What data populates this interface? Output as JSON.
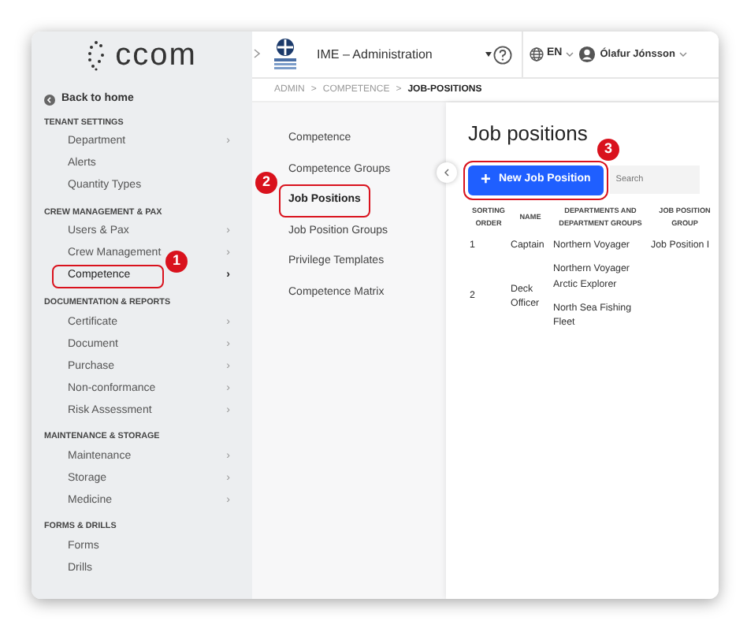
{
  "logo": {
    "text": "ccom"
  },
  "header": {
    "org_name": "IME – Administration",
    "language": "EN",
    "user": "Ólafur Jónsson"
  },
  "breadcrumb": [
    {
      "label": "ADMIN",
      "current": false
    },
    {
      "label": "COMPETENCE",
      "current": false
    },
    {
      "label": "JOB-POSITIONS",
      "current": true
    }
  ],
  "breadcrumb_separator": ">",
  "sidebar": {
    "back": "Back to home",
    "sections": [
      {
        "title": "TENANT SETTINGS",
        "items": [
          {
            "label": "Department",
            "chevron": "›",
            "selected": false
          },
          {
            "label": "Alerts",
            "selected": false
          },
          {
            "label": "Quantity Types",
            "selected": false
          }
        ]
      },
      {
        "title": "CREW MANAGEMENT & PAX",
        "items": [
          {
            "label": "Users & Pax",
            "chevron": "›",
            "selected": false
          },
          {
            "label": "Crew Management",
            "chevron": "›",
            "selected": false
          },
          {
            "label": "Competence",
            "chevron": "›",
            "selected": true,
            "callout": "1"
          }
        ]
      },
      {
        "title": "DOCUMENTATION & REPORTS",
        "items": [
          {
            "label": "Certificate",
            "chevron": "›",
            "selected": false
          },
          {
            "label": "Document",
            "chevron": "›",
            "selected": false
          },
          {
            "label": "Purchase",
            "chevron": "›",
            "selected": false
          },
          {
            "label": "Non-conformance",
            "chevron": "›",
            "selected": false
          },
          {
            "label": "Risk Assessment",
            "chevron": "›",
            "selected": false
          }
        ]
      },
      {
        "title": "MAINTENANCE & STORAGE",
        "items": [
          {
            "label": "Maintenance",
            "chevron": "›",
            "selected": false
          },
          {
            "label": "Storage",
            "chevron": "›",
            "selected": false
          },
          {
            "label": "Medicine",
            "chevron": "›",
            "selected": false
          }
        ]
      },
      {
        "title": "FORMS & DRILLS",
        "items": [
          {
            "label": "Forms",
            "selected": false
          },
          {
            "label": "Drills",
            "selected": false
          }
        ]
      }
    ]
  },
  "submenu": [
    {
      "label": "Competence",
      "selected": false
    },
    {
      "label": "Competence Groups",
      "selected": false
    },
    {
      "label": "Job Positions",
      "selected": true,
      "callout": "2"
    },
    {
      "label": "Job Position Groups",
      "selected": false
    },
    {
      "label": "Privilege Templates",
      "selected": false
    },
    {
      "label": "Competence Matrix",
      "selected": false
    }
  ],
  "content": {
    "title": "Job positions",
    "new_button": {
      "icon": "+",
      "label": "New Job Position",
      "callout": "3"
    },
    "search": {
      "placeholder": "Search"
    },
    "table": {
      "columns": [
        "SORTING ORDER",
        "NAME",
        "DEPARTMENTS AND DEPARTMENT GROUPS",
        "JOB POSITION GROUP"
      ],
      "rows": [
        {
          "sorting_order": "1",
          "name": "Captain",
          "departments": [
            "Northern Voyager"
          ],
          "job_position_group": "Job Position I"
        },
        {
          "sorting_order": "2",
          "name": "Deck Officer",
          "departments": [
            "Northern Voyager Arctic Explorer",
            "North Sea Fishing Fleet"
          ]
        }
      ]
    }
  }
}
